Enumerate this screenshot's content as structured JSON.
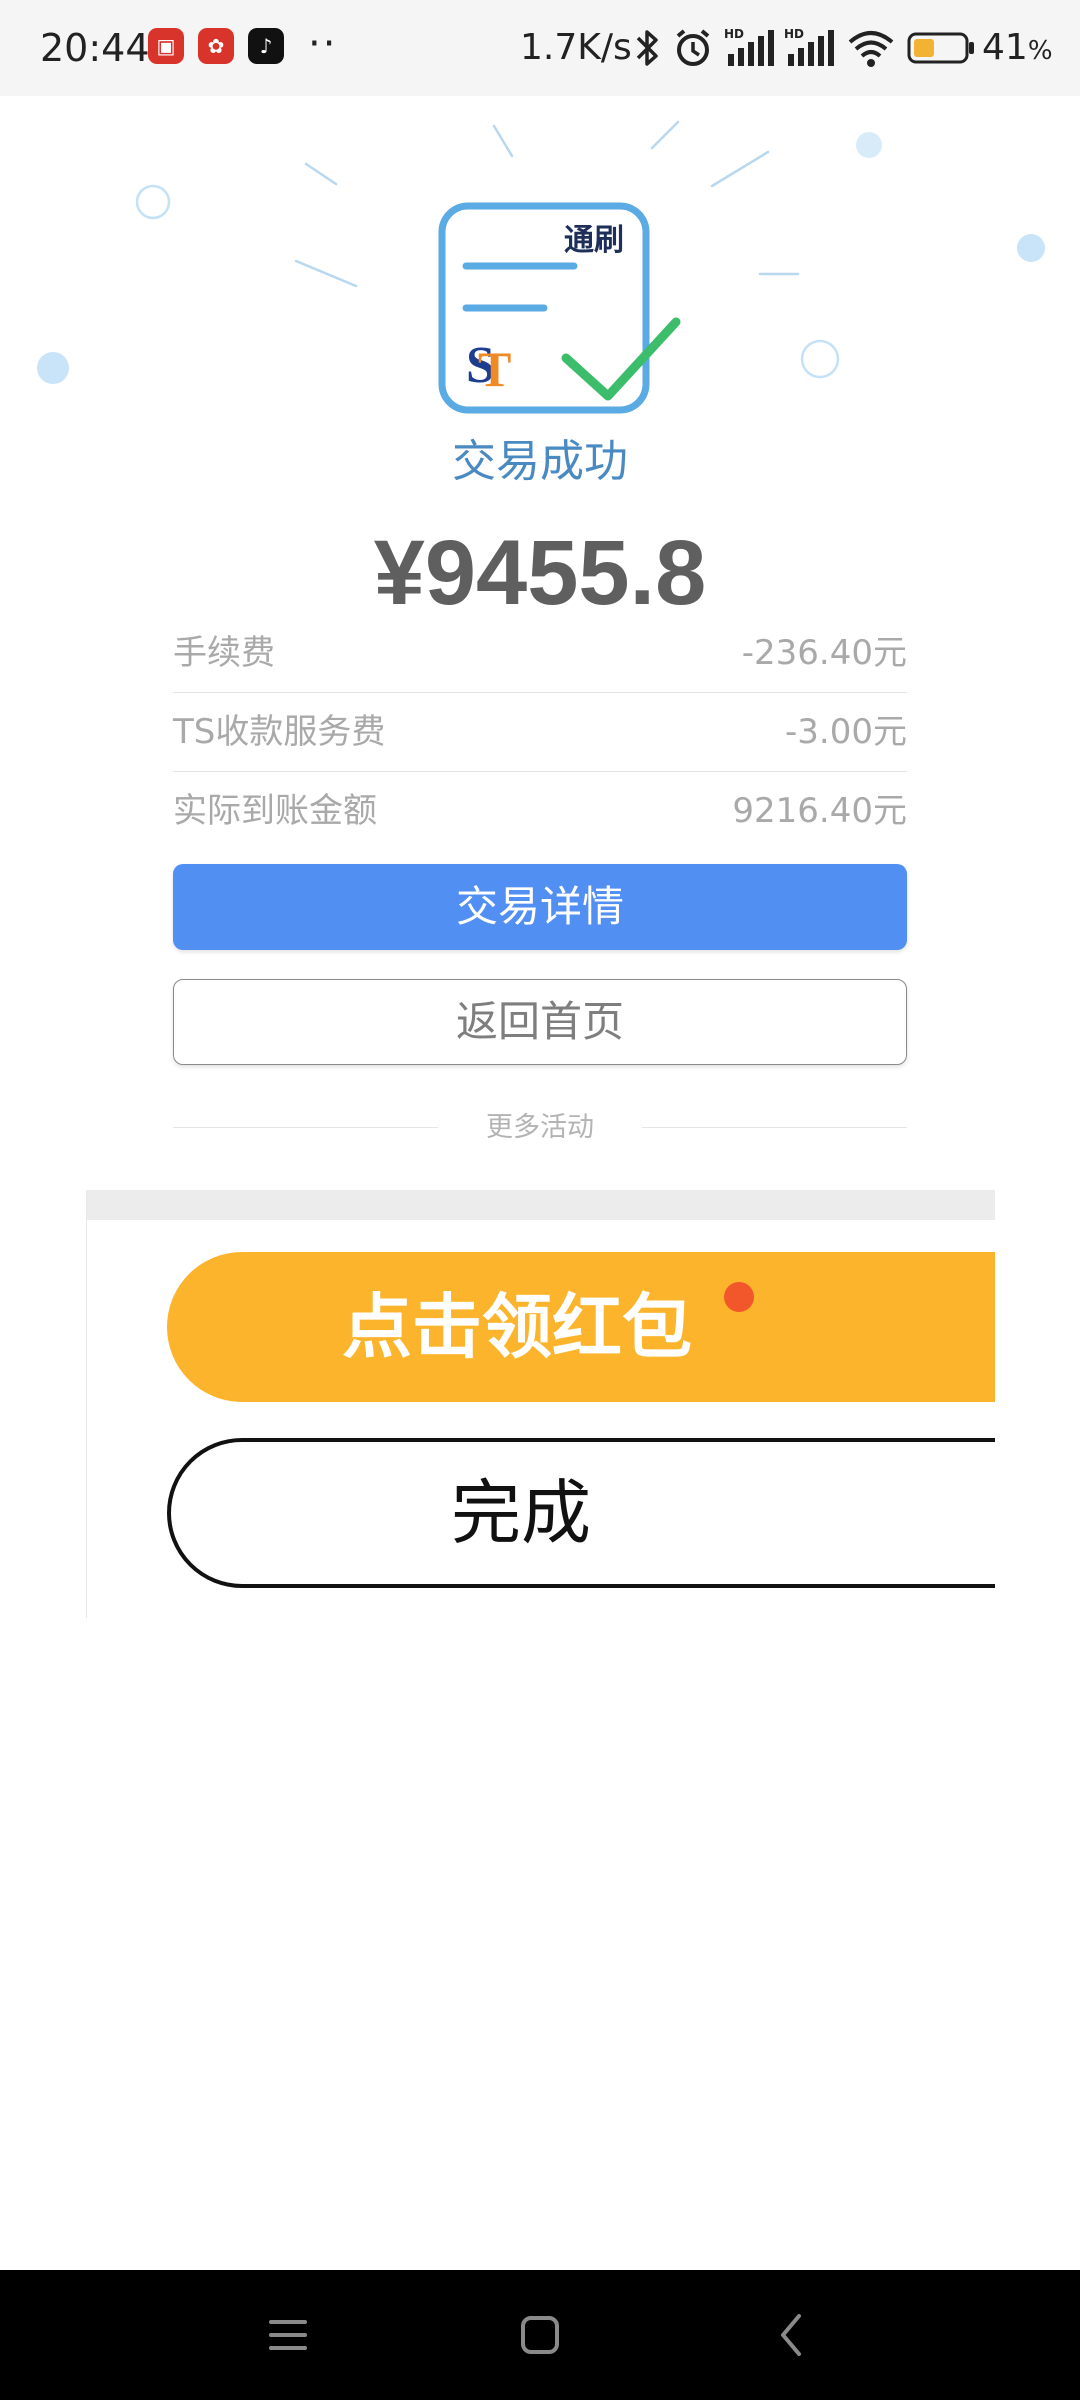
{
  "status_bar": {
    "time": "20:44",
    "dots": "··",
    "network_speed": "1.7K/s",
    "battery_percent": "41",
    "battery_unit": "%",
    "battery_level": 0.41,
    "hd_label": "HD",
    "app_icons": [
      "bank-app-icon",
      "flower-app-icon",
      "tiktok-app-icon"
    ]
  },
  "result": {
    "title": "交易成功",
    "amount": "¥9455.8",
    "logo_text": "通刷"
  },
  "fees": [
    {
      "label": "手续费",
      "value": "-236.40元"
    },
    {
      "label": "TS收款服务费",
      "value": "-3.00元"
    },
    {
      "label": "实际到账金额",
      "value": "9216.40元"
    }
  ],
  "buttons": {
    "detail": "交易详情",
    "home": "返回首页"
  },
  "more": {
    "label": "更多活动"
  },
  "activity": {
    "redpacket_label": "点击领红包",
    "done_label": "完成"
  },
  "colors": {
    "primary_blue": "#528ff3",
    "success_title": "#4a8ac2",
    "redpacket_yellow": "#fbb42b",
    "notification_dot": "#f1572b"
  }
}
